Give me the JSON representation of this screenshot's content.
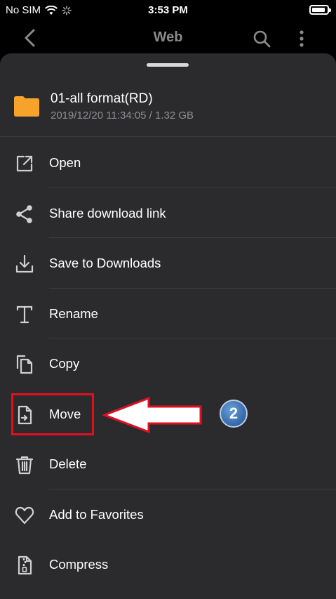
{
  "status_bar": {
    "carrier": "No SIM",
    "time": "3:53 PM"
  },
  "nav": {
    "title": "Web"
  },
  "file": {
    "name": "01-all format(RD)",
    "meta": "2019/12/20 11:34:05 / 1.32 GB"
  },
  "menu": [
    {
      "label": "Open",
      "icon": "open-external-icon"
    },
    {
      "label": "Share download link",
      "icon": "share-icon"
    },
    {
      "label": "Save to Downloads",
      "icon": "download-icon"
    },
    {
      "label": "Rename",
      "icon": "text-rename-icon"
    },
    {
      "label": "Copy",
      "icon": "copy-icon"
    },
    {
      "label": "Move",
      "icon": "move-file-icon"
    },
    {
      "label": "Delete",
      "icon": "trash-icon"
    },
    {
      "label": "Add to Favorites",
      "icon": "heart-icon"
    },
    {
      "label": "Compress",
      "icon": "zip-file-icon"
    }
  ],
  "annotation": {
    "step_number": "2",
    "highlight_color": "#e01020"
  },
  "colors": {
    "sheet_background": "#2b2b2d",
    "folder": "#f7a22b",
    "secondary_text": "#8e8e93"
  }
}
